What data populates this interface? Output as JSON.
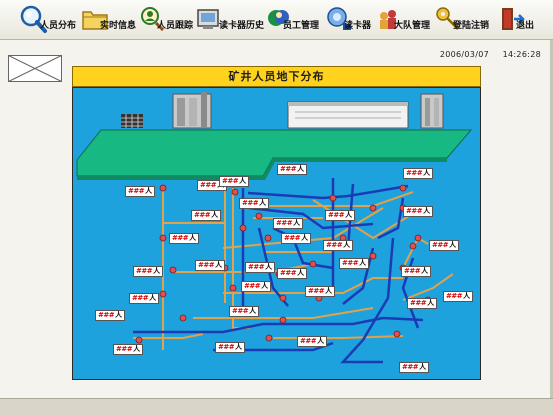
{
  "toolbar": {
    "items": [
      {
        "label": "人员分布",
        "icon": "magnifier-icon"
      },
      {
        "label": "实时信息",
        "icon": "folder-icon"
      },
      {
        "label": "人员跟踪",
        "icon": "tracking-icon"
      },
      {
        "label": "读卡器历史",
        "icon": "reader-history-icon"
      },
      {
        "label": "员工管理",
        "icon": "staff-icon"
      },
      {
        "label": "读卡器",
        "icon": "reader-icon"
      },
      {
        "label": "大队管理",
        "icon": "team-icon"
      },
      {
        "label": "登陆注销",
        "icon": "key-icon"
      },
      {
        "label": "退出",
        "icon": "exit-door-icon"
      }
    ]
  },
  "status": {
    "date": "2006/03/07",
    "time": "14:26:28"
  },
  "map": {
    "title": "矿井人员地下分布",
    "tag_value": "###",
    "tag_unit": "人",
    "tags": [
      {
        "id": "t1"
      },
      {
        "id": "t2"
      },
      {
        "id": "t3"
      },
      {
        "id": "t4"
      },
      {
        "id": "t5"
      },
      {
        "id": "t6"
      },
      {
        "id": "t7"
      },
      {
        "id": "t8"
      },
      {
        "id": "t9"
      },
      {
        "id": "t10"
      },
      {
        "id": "t11"
      },
      {
        "id": "t12"
      },
      {
        "id": "t13"
      },
      {
        "id": "t14"
      },
      {
        "id": "t15"
      },
      {
        "id": "t16"
      },
      {
        "id": "t17"
      },
      {
        "id": "t18"
      },
      {
        "id": "t19"
      },
      {
        "id": "t20"
      },
      {
        "id": "t21"
      },
      {
        "id": "t22"
      },
      {
        "id": "t23"
      },
      {
        "id": "t24"
      },
      {
        "id": "t25"
      },
      {
        "id": "t26"
      },
      {
        "id": "t27"
      },
      {
        "id": "t28"
      },
      {
        "id": "t29"
      },
      {
        "id": "t30"
      },
      {
        "id": "t31"
      }
    ]
  },
  "colors": {
    "panel": "#1ea2de",
    "ground": "#18b883",
    "tunnel_blue": "#1a3bb5",
    "tunnel_tan": "#e0a24a",
    "title_bar": "#ffd21e",
    "node": "#e05050"
  }
}
